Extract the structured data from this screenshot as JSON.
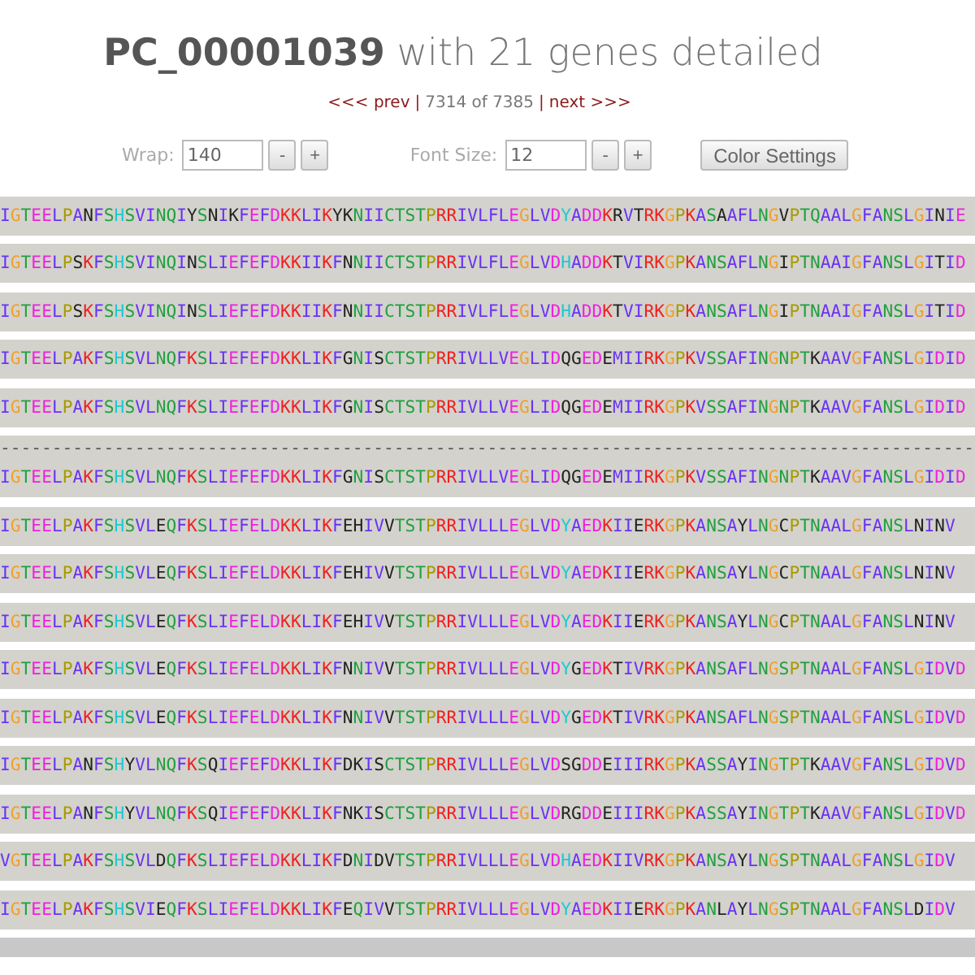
{
  "title": "**PC_00001039** with 21 genes detailed",
  "nav": [
    {
      "kind": "link",
      "text": "<<< prev"
    },
    {
      "kind": "sep",
      "text": "|"
    },
    {
      "kind": "text",
      "text": "7314 of 7385"
    },
    {
      "kind": "sep",
      "text": "|"
    },
    {
      "kind": "link",
      "text": "next >>>"
    }
  ],
  "controls": [
    {
      "label": "Wrap:",
      "value": "140",
      "buttons": [
        "-",
        "+"
      ]
    },
    {
      "label": "Font Size:",
      "value": "12",
      "buttons": [
        "-",
        "+"
      ]
    }
  ],
  "color_button": "Color Settings",
  "rows": [
    {
      "kind": "seq",
      "text": "IGTEELPANFSHSVINQIYSNIKFEFDKKLIKYKNIICTSTPRRIVLFLEGLVDYADDKRVTRKGPKASAAFLNGVPTQAALGFANSLGINIE"
    },
    {
      "kind": "seq",
      "text": "IGTEELPSKFSHSVINQINSLIEFEFDKKIIKFNNIICTSTPRRIVLFLEGLVDHADDKTVIRKGPKANSAFLNGIPTNAAIGFANSLGITID"
    },
    {
      "kind": "seq",
      "text": "IGTEELPSKFSHSVINQINSLIEFEFDKKIIKFNNIICTSTPRRIVLFLEGLVDHADDKTVIRKGPKANSAFLNGIPTNAAIGFANSLGITID"
    },
    {
      "kind": "seq",
      "text": "IGTEELPAKFSHSVLNQFKSLIEFEFDKKLIKFGNISCTSTPRRIVLLVEGLIDQGEDEMIIRKGPKVSSAFINGNPTKAAVGFANSLGIDID"
    },
    {
      "kind": "seq",
      "text": "IGTEELPAKFSHSVLNQFKSLIEFEFDKKLIKFGNISCTSTPRRIVLLVEGLIDQGEDEMIIRKGPKVSSAFINGNPTKAAVGFANSLGIDID"
    },
    {
      "kind": "gap",
      "text": "----------------------------------------------------------------------------------------------"
    },
    {
      "kind": "seq",
      "text": "IGTEELPAKFSHSVLNQFKSLIEFEFDKKLIKFGNISCTSTPRRIVLLVEGLIDQGEDEMIIRKGPKVSSAFINGNPTKAAVGFANSLGIDID"
    },
    {
      "kind": "seq",
      "text": "IGTEELPAKFSHSVLEQFKSLIEFELDKKLIKFEHIVVTSTPRRIVLLLEGLVDYAEDKIIERKGPKANSAYLNGCPTNAALGFANSLNINV"
    },
    {
      "kind": "seq",
      "text": "IGTEELPAKFSHSVLEQFKSLIEFELDKKLIKFEHIVVTSTPRRIVLLLEGLVDYAEDKIIERKGPKANSAYLNGCPTNAALGFANSLNINV"
    },
    {
      "kind": "seq",
      "text": "IGTEELPAKFSHSVLEQFKSLIEFELDKKLIKFEHIVVTSTPRRIVLLLEGLVDYAEDKIIERKGPKANSAYLNGCPTNAALGFANSLNINV"
    },
    {
      "kind": "seq",
      "text": "IGTEELPAKFSHSVLEQFKSLIEFELDKKLIKFNNIVVTSTPRRIVLLLEGLVDYGEDKTIVRKGPKANSAFLNGSPTNAALGFANSLGIDVD"
    },
    {
      "kind": "seq",
      "text": "IGTEELPAKFSHSVLEQFKSLIEFELDKKLIKFNNIVVTSTPRRIVLLLEGLVDYGEDKTIVRKGPKANSAFLNGSPTNAALGFANSLGIDVD"
    },
    {
      "kind": "seq",
      "text": "IGTEELPANFSHYVLNQFKSQIEFEFDKKLIKFDKISCTSTPRRIVLLLEGLVDSGDDEIIIRKGPKASSAYINGTPTKAAVGFANSLGIDVD"
    },
    {
      "kind": "seq",
      "text": "IGTEELPANFSHYVLNQFKSQIEFEFDKKLIKFNKISCTSTPRRIVLLLEGLVDRGDDEIIIRKGPKASSAYINGTPTKAAVGFANSLGIDVD"
    },
    {
      "kind": "seq",
      "text": "VGTEELPAKFSHSVLDQFKSLIEFELDKKLIKFDNIDVTSTPRRIVLLLEGLVDHAEDKIIVRKGPKANSAYLNGSPTNAALGFANSLGIDV"
    },
    {
      "kind": "seq",
      "text": "IGTEELPAKFSHSVIEQFKSLIEFELDKKLIKFEQIVVTSTPRRIVLLLEGLVDYAEDKIIERKGPKANLAYLNGSPTNAALGFANSLDIDV"
    },
    {
      "kind": "bar"
    }
  ]
}
